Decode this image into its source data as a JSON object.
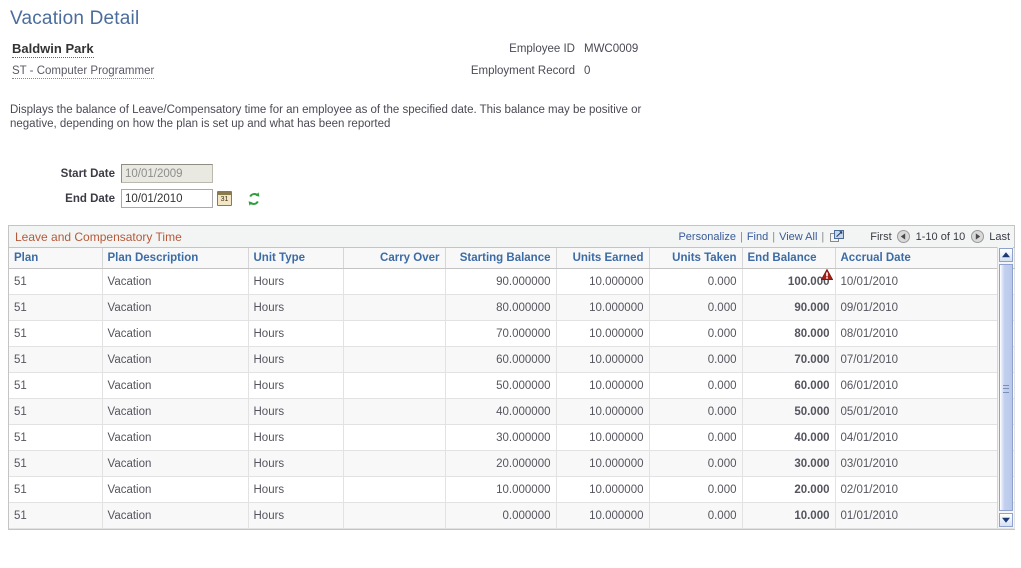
{
  "page": {
    "title": "Vacation Detail",
    "employee_name": "Baldwin Park",
    "job_title": "ST - Computer Programmer",
    "employee_id_label": "Employee ID",
    "employee_id_value": "MWC0009",
    "employment_record_label": "Employment Record",
    "employment_record_value": "0",
    "description": "Displays the balance of Leave/Compensatory time for an employee as of the specified date. This balance may be positive or negative, depending on how the plan is set up and what has been reported"
  },
  "filters": {
    "start_date_label": "Start Date",
    "start_date_value": "10/01/2009",
    "end_date_label": "End Date",
    "end_date_value": "10/01/2010",
    "calendar_icon": "calendar-icon",
    "refresh_icon": "refresh-icon"
  },
  "grid": {
    "title": "Leave and Compensatory Time",
    "personalize_label": "Personalize",
    "find_label": "Find",
    "view_all_label": "View All",
    "new_window_icon": "new-window-icon",
    "first_label": "First",
    "last_label": "Last",
    "range_label": "1-10 of 10",
    "prev_icon": "previous-page-icon",
    "next_icon": "next-page-icon",
    "columns": [
      "Plan",
      "Plan Description",
      "Unit Type",
      "Carry Over",
      "Starting Balance",
      "Units Earned",
      "Units Taken",
      "End Balance",
      "Accrual Date"
    ],
    "rows": [
      {
        "plan": "51",
        "plan_description": "Vacation",
        "unit_type": "Hours",
        "carry_over": "",
        "starting_balance": "90.000000",
        "units_earned": "10.000000",
        "units_taken": "0.000",
        "end_balance": "100.000",
        "accrual_date": "10/01/2010",
        "warning": true
      },
      {
        "plan": "51",
        "plan_description": "Vacation",
        "unit_type": "Hours",
        "carry_over": "",
        "starting_balance": "80.000000",
        "units_earned": "10.000000",
        "units_taken": "0.000",
        "end_balance": "90.000",
        "accrual_date": "09/01/2010",
        "warning": false
      },
      {
        "plan": "51",
        "plan_description": "Vacation",
        "unit_type": "Hours",
        "carry_over": "",
        "starting_balance": "70.000000",
        "units_earned": "10.000000",
        "units_taken": "0.000",
        "end_balance": "80.000",
        "accrual_date": "08/01/2010",
        "warning": false
      },
      {
        "plan": "51",
        "plan_description": "Vacation",
        "unit_type": "Hours",
        "carry_over": "",
        "starting_balance": "60.000000",
        "units_earned": "10.000000",
        "units_taken": "0.000",
        "end_balance": "70.000",
        "accrual_date": "07/01/2010",
        "warning": false
      },
      {
        "plan": "51",
        "plan_description": "Vacation",
        "unit_type": "Hours",
        "carry_over": "",
        "starting_balance": "50.000000",
        "units_earned": "10.000000",
        "units_taken": "0.000",
        "end_balance": "60.000",
        "accrual_date": "06/01/2010",
        "warning": false
      },
      {
        "plan": "51",
        "plan_description": "Vacation",
        "unit_type": "Hours",
        "carry_over": "",
        "starting_balance": "40.000000",
        "units_earned": "10.000000",
        "units_taken": "0.000",
        "end_balance": "50.000",
        "accrual_date": "05/01/2010",
        "warning": false
      },
      {
        "plan": "51",
        "plan_description": "Vacation",
        "unit_type": "Hours",
        "carry_over": "",
        "starting_balance": "30.000000",
        "units_earned": "10.000000",
        "units_taken": "0.000",
        "end_balance": "40.000",
        "accrual_date": "04/01/2010",
        "warning": false
      },
      {
        "plan": "51",
        "plan_description": "Vacation",
        "unit_type": "Hours",
        "carry_over": "",
        "starting_balance": "20.000000",
        "units_earned": "10.000000",
        "units_taken": "0.000",
        "end_balance": "30.000",
        "accrual_date": "03/01/2010",
        "warning": false
      },
      {
        "plan": "51",
        "plan_description": "Vacation",
        "unit_type": "Hours",
        "carry_over": "",
        "starting_balance": "10.000000",
        "units_earned": "10.000000",
        "units_taken": "0.000",
        "end_balance": "20.000",
        "accrual_date": "02/01/2010",
        "warning": false
      },
      {
        "plan": "51",
        "plan_description": "Vacation",
        "unit_type": "Hours",
        "carry_over": "",
        "starting_balance": "0.000000",
        "units_earned": "10.000000",
        "units_taken": "0.000",
        "end_balance": "10.000",
        "accrual_date": "01/01/2010",
        "warning": false
      }
    ]
  },
  "colors": {
    "title_blue": "#4a6d9c",
    "grid_title_orange": "#b5593b",
    "header_blue": "#3c6ba5",
    "link_blue": "#3a5a9b",
    "warning_red": "#c0392b"
  }
}
